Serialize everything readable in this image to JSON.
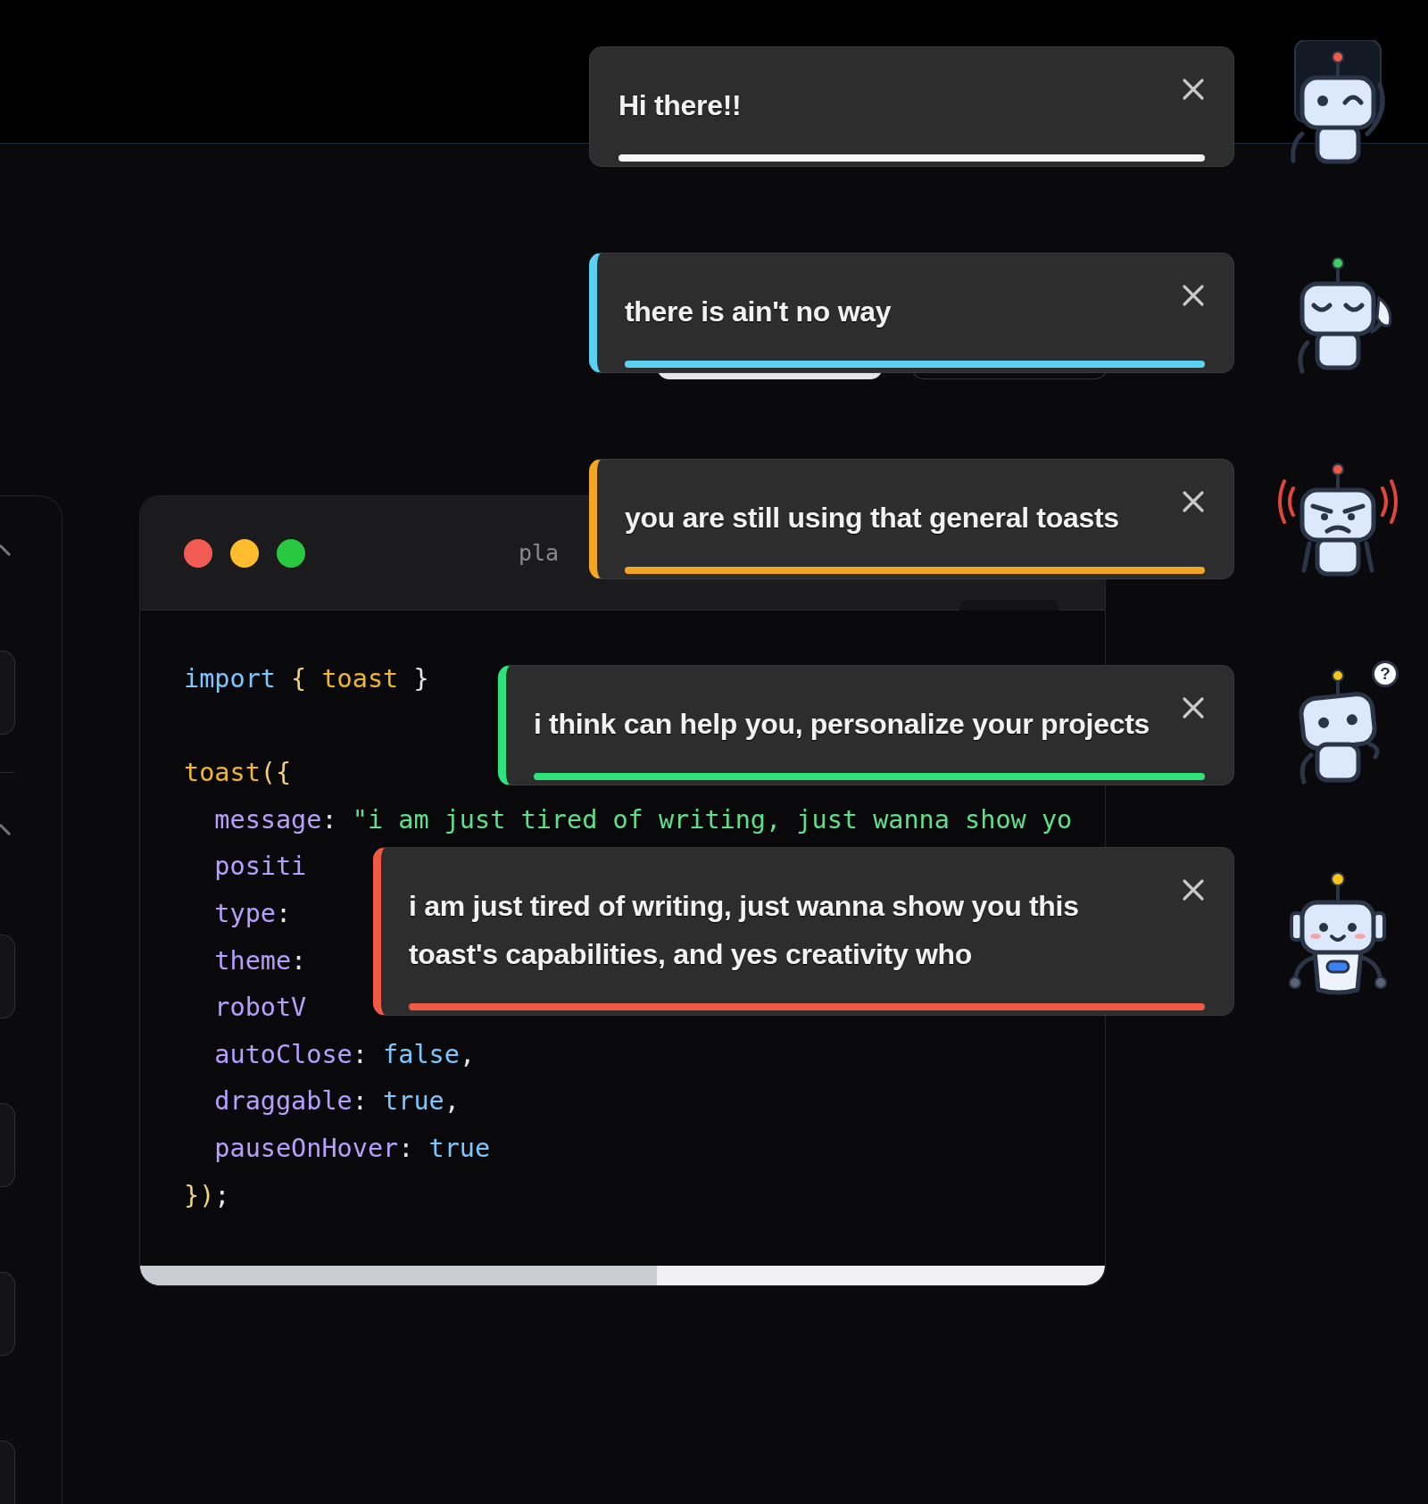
{
  "code_window": {
    "header_text": "pla",
    "lines": [
      {
        "kind": "code",
        "indent": false,
        "tokens": [
          {
            "kind": "keyword",
            "text": "import"
          },
          {
            "kind": "brace",
            "text": " { "
          },
          {
            "kind": "fn",
            "text": "toast"
          },
          {
            "kind": "punct",
            "text": " }"
          }
        ]
      },
      {
        "kind": "blank"
      },
      {
        "kind": "code",
        "indent": false,
        "tokens": [
          {
            "kind": "fn",
            "text": "toast"
          },
          {
            "kind": "brace",
            "text": "({"
          }
        ]
      },
      {
        "kind": "code",
        "indent": true,
        "tokens": [
          {
            "kind": "prop",
            "text": "message"
          },
          {
            "kind": "punct",
            "text": ": "
          },
          {
            "kind": "string",
            "text": "\"i am just tired of writing, just wanna show yo"
          }
        ]
      },
      {
        "kind": "code",
        "indent": true,
        "tokens": [
          {
            "kind": "prop",
            "text": "positi"
          }
        ]
      },
      {
        "kind": "code",
        "indent": true,
        "tokens": [
          {
            "kind": "prop",
            "text": "type"
          },
          {
            "kind": "punct",
            "text": ":"
          }
        ]
      },
      {
        "kind": "code",
        "indent": true,
        "tokens": [
          {
            "kind": "prop",
            "text": "theme"
          },
          {
            "kind": "punct",
            "text": ":"
          }
        ]
      },
      {
        "kind": "code",
        "indent": true,
        "tokens": [
          {
            "kind": "prop",
            "text": "robotV"
          }
        ]
      },
      {
        "kind": "code",
        "indent": true,
        "tokens": [
          {
            "kind": "prop",
            "text": "autoClose"
          },
          {
            "kind": "punct",
            "text": ": "
          },
          {
            "kind": "keyword",
            "text": "false"
          },
          {
            "kind": "punct",
            "text": ","
          }
        ]
      },
      {
        "kind": "code",
        "indent": true,
        "tokens": [
          {
            "kind": "prop",
            "text": "draggable"
          },
          {
            "kind": "punct",
            "text": ": "
          },
          {
            "kind": "keyword",
            "text": "true"
          },
          {
            "kind": "punct",
            "text": ","
          }
        ]
      },
      {
        "kind": "code",
        "indent": true,
        "tokens": [
          {
            "kind": "prop",
            "text": "pauseOnHover"
          },
          {
            "kind": "punct",
            "text": ": "
          },
          {
            "kind": "keyword",
            "text": "true"
          }
        ]
      },
      {
        "kind": "code",
        "indent": false,
        "tokens": [
          {
            "kind": "brace",
            "text": "})"
          },
          {
            "kind": "punct",
            "text": ";"
          }
        ]
      }
    ]
  },
  "toasts": [
    {
      "kind": "default",
      "message": "Hi there!!",
      "color": "#f5f5f5"
    },
    {
      "kind": "info",
      "message": "there is ain't no way",
      "color": "#5bd0f0"
    },
    {
      "kind": "warning",
      "message": "you are still using that general toasts",
      "color": "#f5a524"
    },
    {
      "kind": "success",
      "message": "i think can help you, personalize your projects",
      "color": "#2ee37a",
      "robot_badge": "?"
    },
    {
      "kind": "error",
      "message": "i am just tired of writing, just wanna show you this toast's capabilities, and yes creativity who",
      "color": "#f05a44"
    }
  ]
}
